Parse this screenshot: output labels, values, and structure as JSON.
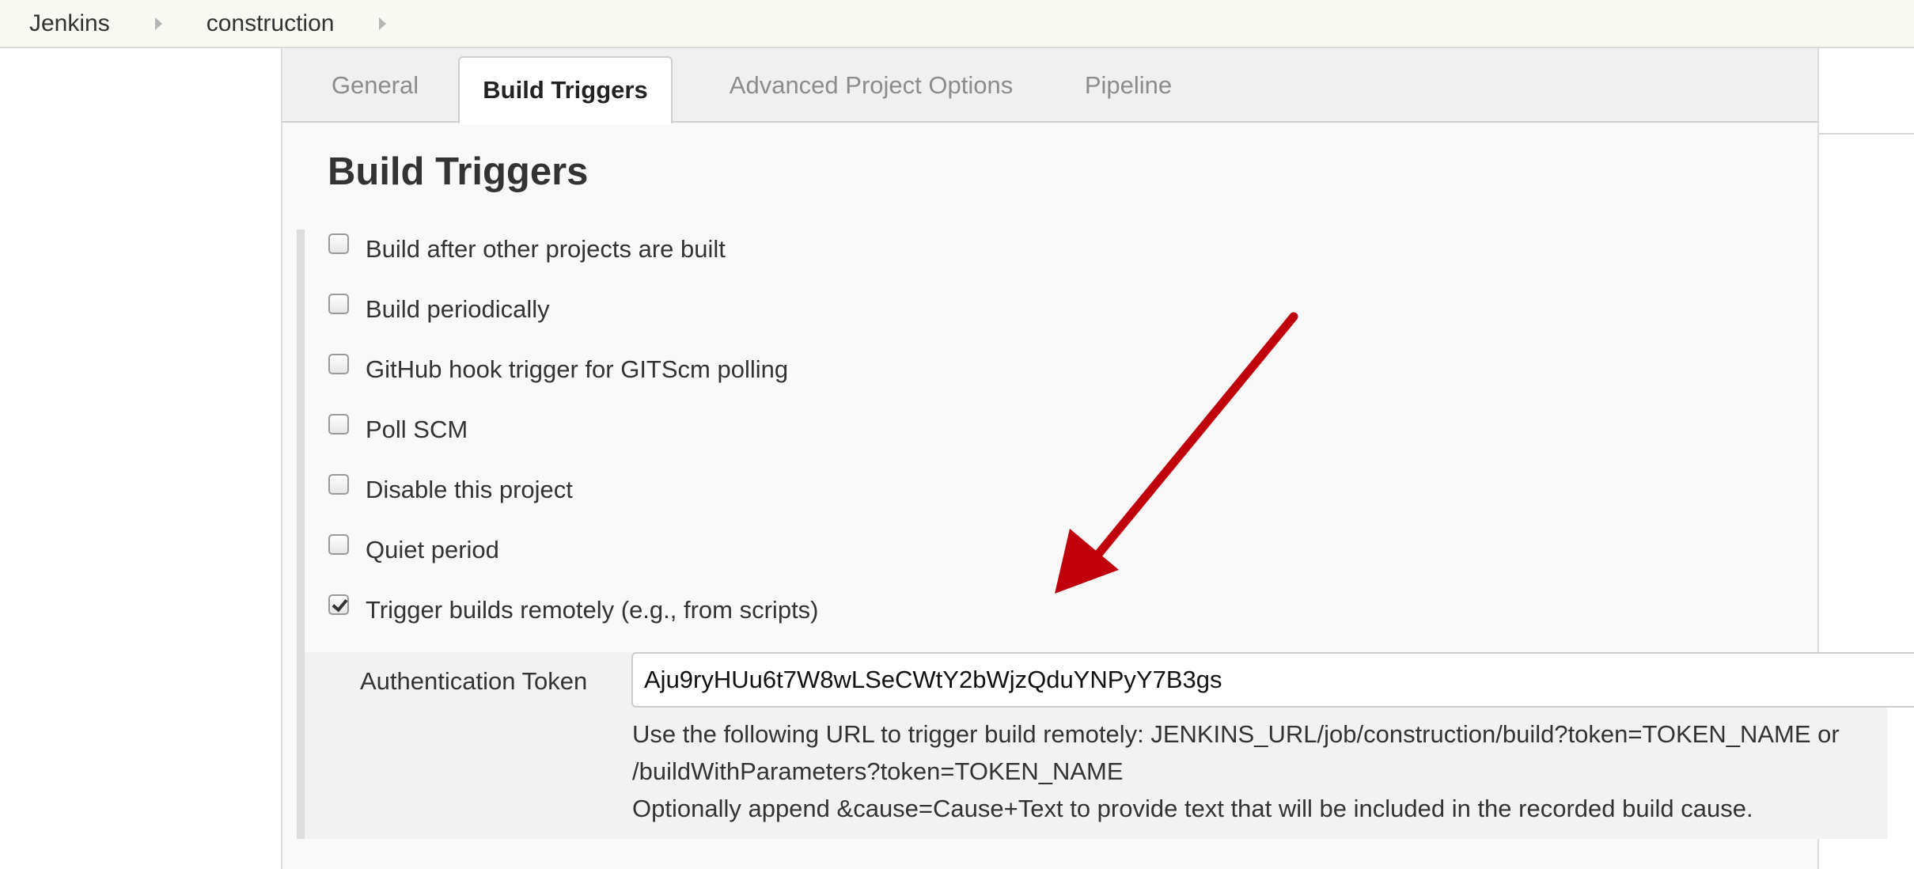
{
  "breadcrumb": {
    "items": [
      "Jenkins",
      "construction"
    ]
  },
  "tabs": [
    {
      "label": "General",
      "active": false
    },
    {
      "label": "Build Triggers",
      "active": true
    },
    {
      "label": "Advanced Project Options",
      "active": false
    },
    {
      "label": "Pipeline",
      "active": false
    }
  ],
  "section": {
    "title": "Build Triggers"
  },
  "options": [
    {
      "label": "Build after other projects are built",
      "checked": false
    },
    {
      "label": "Build periodically",
      "checked": false
    },
    {
      "label": "GitHub hook trigger for GITScm polling",
      "checked": false
    },
    {
      "label": "Poll SCM",
      "checked": false
    },
    {
      "label": "Disable this project",
      "checked": false
    },
    {
      "label": "Quiet period",
      "checked": false
    },
    {
      "label": "Trigger builds remotely (e.g., from scripts)",
      "checked": true
    }
  ],
  "token": {
    "label": "Authentication Token",
    "value": "Aju9ryHUu6t7W8wLSeCWtY2bWjzQduYNPyY7B3gs",
    "help_line1": "Use the following URL to trigger build remotely: JENKINS_URL/job/construction/build?token=TOKEN_NAME or",
    "help_line2": "/buildWithParameters?token=TOKEN_NAME",
    "help_line3": "Optionally append &cause=Cause+Text to provide text that will be included in the recorded build cause."
  },
  "colors": {
    "annotation_arrow": "#c0000a",
    "breadcrumb_bg": "#f7f9f2"
  }
}
